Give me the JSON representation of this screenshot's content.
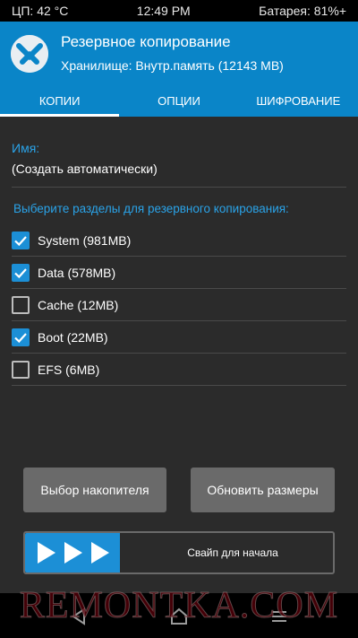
{
  "status_bar": {
    "cpu": "ЦП: 42 °C",
    "time": "12:49 PM",
    "battery": "Батарея: 81%+"
  },
  "header": {
    "title": "Резервное копирование",
    "subtitle": "Хранилище: Внутр.память (12143 MB)",
    "logo_icon": "twrp-logo-icon"
  },
  "tabs": [
    {
      "label": "КОПИИ",
      "active": true
    },
    {
      "label": "ОПЦИИ",
      "active": false
    },
    {
      "label": "ШИФРОВАНИЕ",
      "active": false
    }
  ],
  "backup": {
    "name_label": "Имя:",
    "name_value": "(Создать автоматически)",
    "partitions_label": "Выберите разделы для резервного копирования:",
    "partitions": [
      {
        "label": "System (981MB)",
        "checked": true
      },
      {
        "label": "Data (578MB)",
        "checked": true
      },
      {
        "label": "Cache (12MB)",
        "checked": false
      },
      {
        "label": "Boot (22MB)",
        "checked": true
      },
      {
        "label": "EFS (6MB)",
        "checked": false
      }
    ]
  },
  "buttons": {
    "select_storage": "Выбор накопителя",
    "refresh_sizes": "Обновить размеры"
  },
  "swipe": {
    "label": "Свайп для начала",
    "icon": "triple-arrow-right-icon"
  },
  "navbar": {
    "back_icon": "back-triangle-icon",
    "home_icon": "home-icon",
    "menu_icon": "menu-lines-icon"
  },
  "watermark": "REMONTKA.COM",
  "colors": {
    "accent": "#0a85c8",
    "checkbox": "#1c8fd6",
    "label_blue": "#2aa3e8",
    "panel": "#2b2b2b",
    "button": "#6a6a6a"
  }
}
